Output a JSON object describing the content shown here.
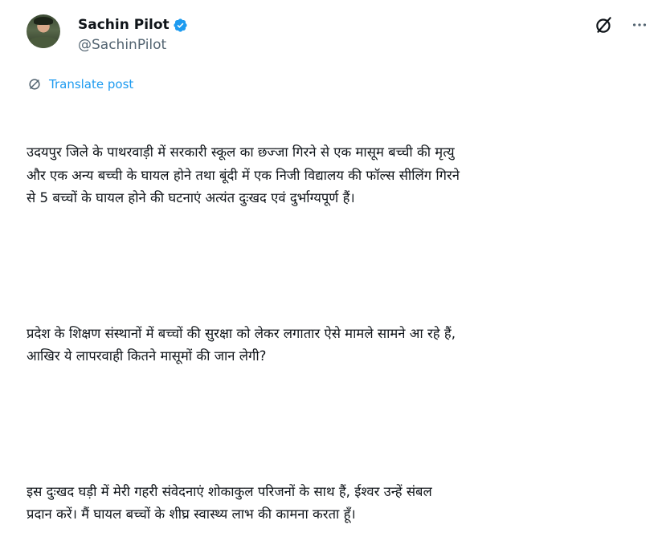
{
  "author": {
    "name": "Sachin Pilot",
    "handle": "@SachinPilot",
    "verified_color": "#1d9bf0"
  },
  "icons": {
    "grok": "grok-icon",
    "more": "more-options-icon",
    "translate": "translate-icon"
  },
  "translate_label": "Translate post",
  "paragraphs": [
    "उदयपुर जिले के पाथरवाड़ी में सरकारी स्कूल का छज्जा गिरने से एक मासूम बच्ची की मृत्यु\nऔर एक अन्य बच्ची के घायल होने तथा बूंदी में एक निजी विद्यालय की फॉल्स सीलिंग गिरने\nसे 5 बच्चों के घायल होने की घटनाएं अत्यंत दुःखद एवं दुर्भाग्यपूर्ण हैं।",
    "प्रदेश के शिक्षण संस्थानों में बच्चों की सुरक्षा को लेकर लगातार ऐसे मामले सामने आ रहे हैं,\nआखिर ये लापरवाही कितने मासूमों की जान लेगी?",
    "इस दुःखद घड़ी में मेरी गहरी संवेदनाएं शोकाकुल परिजनों के साथ हैं, ईश्वर उन्हें संबल\nप्रदान करें। मैं घायल बच्चों के शीघ्र स्वास्थ्य लाभ की कामना करता हूँ।"
  ]
}
